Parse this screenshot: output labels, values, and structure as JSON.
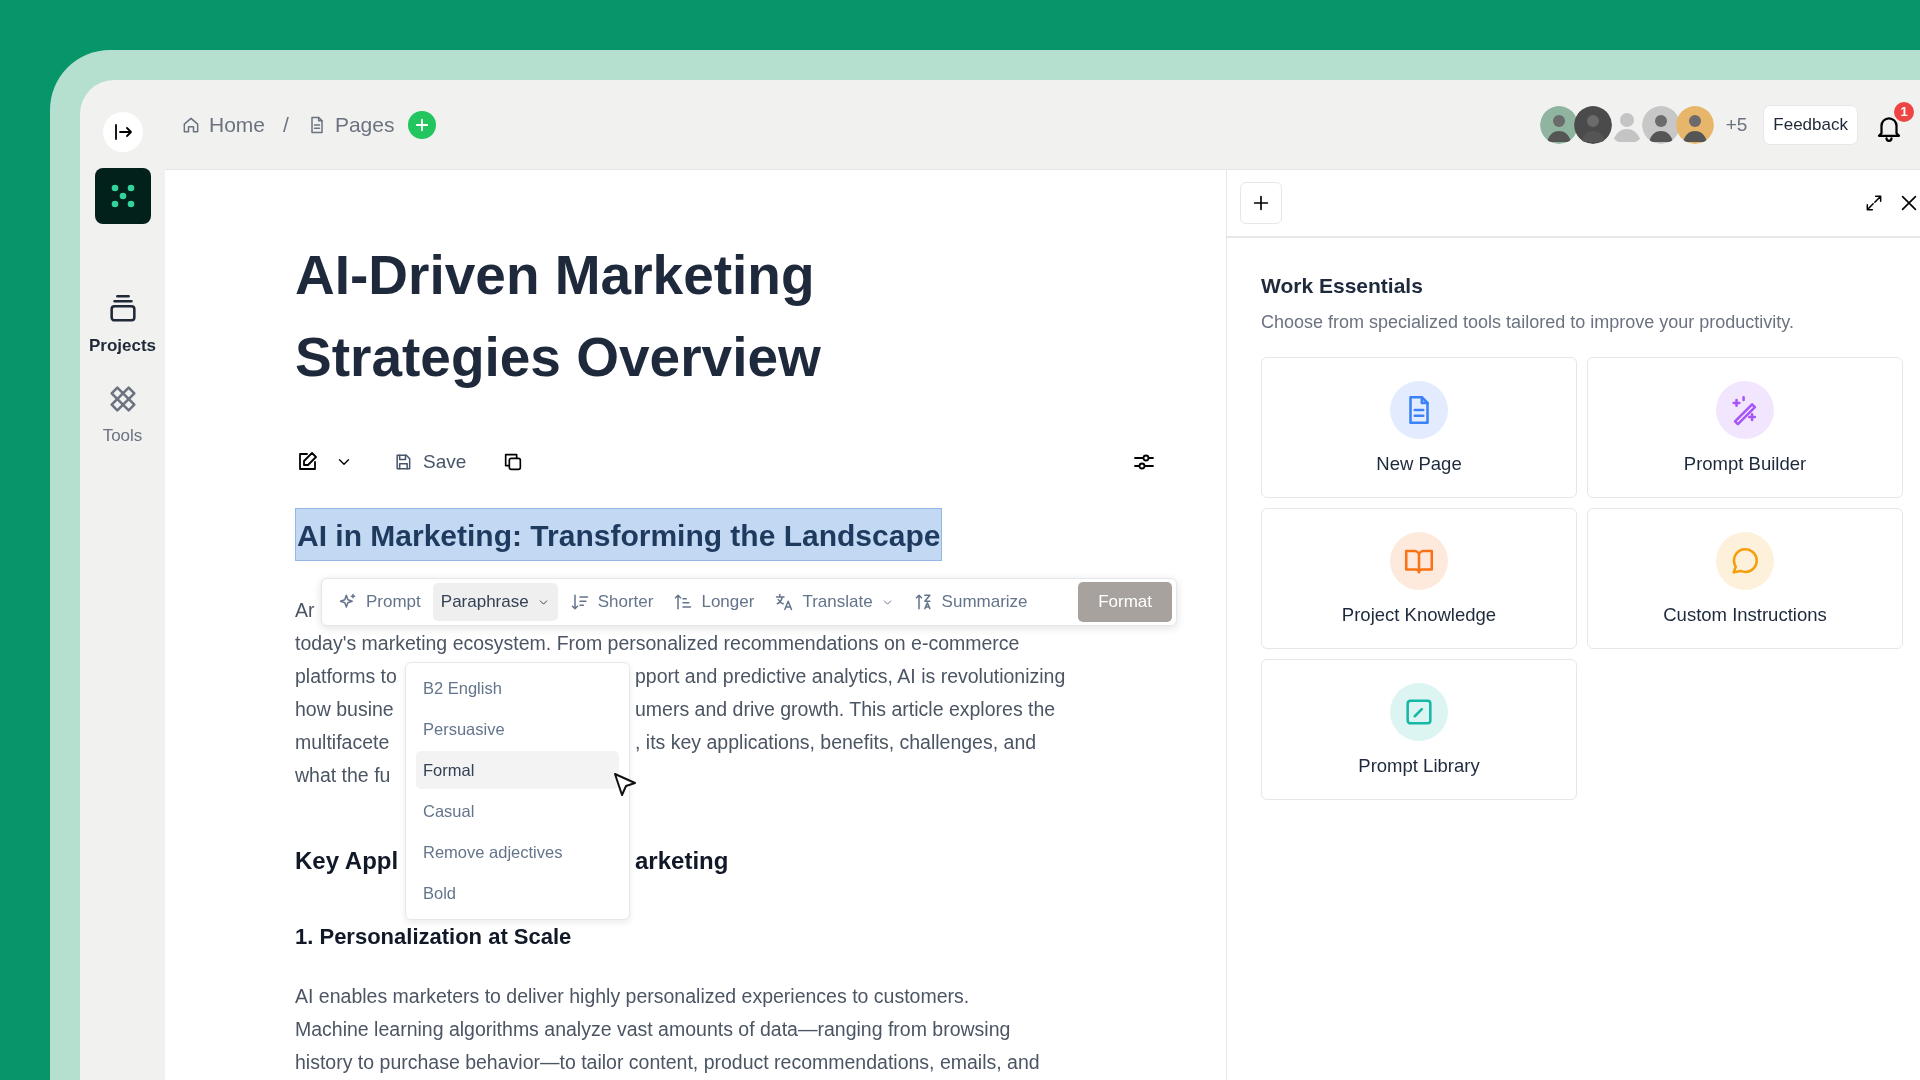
{
  "sidebar": {
    "items": [
      {
        "label": "Projects",
        "selected": true,
        "kind": "projects"
      },
      {
        "label": "Tools",
        "selected": false,
        "kind": "tools"
      }
    ]
  },
  "breadcrumb": {
    "items": [
      {
        "label": "Home",
        "kind": "home"
      },
      {
        "label": "Pages",
        "kind": "page"
      }
    ],
    "separator": "/"
  },
  "collaborators": {
    "avatars": [
      {
        "kind": "photo"
      },
      {
        "kind": "photo"
      },
      {
        "kind": "placeholder"
      },
      {
        "kind": "photo"
      },
      {
        "kind": "photo"
      }
    ],
    "more": "+5"
  },
  "feedback_button": "Feedback",
  "notifications": {
    "badge": "1"
  },
  "document": {
    "title": "AI-Driven Marketing Strategies Overview",
    "toolbar": {
      "save": "Save"
    },
    "selected_heading": "AI in Marketing: Transforming the Landscape",
    "paragraph_lines": [
      {
        "left": "Ar"
      },
      {
        "left": "today's marketing ecosystem. From personalized recommendations on e-commerce"
      },
      {
        "left": "platforms to",
        "right": "pport and predictive analytics, AI is revolutionizing"
      },
      {
        "left": "how busine",
        "right": "umers and drive growth. This article explores the"
      },
      {
        "left": "multifacete",
        "right": ", its key applications, benefits, challenges, and"
      },
      {
        "left": "what the fu"
      }
    ],
    "section_heading": {
      "left": "Key Appl",
      "right": "arketing"
    },
    "subheading": "1. Personalization at Scale",
    "body_lines": [
      "AI enables marketers to deliver highly personalized experiences to customers.",
      "Machine learning algorithms analyze vast amounts of data—ranging from browsing",
      "history to purchase behavior—to tailor content, product recommendations, emails, and"
    ]
  },
  "ai_toolbar": {
    "actions": [
      {
        "label": "Prompt",
        "kind": "prompt",
        "selected": false,
        "dropdown": false
      },
      {
        "label": "Paraphrase",
        "kind": "paraphrase",
        "selected": true,
        "dropdown": true
      },
      {
        "label": "Shorter",
        "kind": "shorter",
        "selected": false,
        "dropdown": false
      },
      {
        "label": "Longer",
        "kind": "longer",
        "selected": false,
        "dropdown": false
      },
      {
        "label": "Translate",
        "kind": "translate",
        "selected": false,
        "dropdown": true
      },
      {
        "label": "Summarize",
        "kind": "summarize",
        "selected": false,
        "dropdown": false
      },
      {
        "label": "Format",
        "kind": "primary",
        "selected": false,
        "dropdown": false
      }
    ]
  },
  "paraphrase_menu": {
    "items": [
      {
        "label": "B2 English",
        "selected": false
      },
      {
        "label": "Persuasive",
        "selected": false
      },
      {
        "label": "Formal",
        "selected": true
      },
      {
        "label": "Casual",
        "selected": false
      },
      {
        "label": "Remove adjectives",
        "selected": false
      },
      {
        "label": "Bold",
        "selected": false
      }
    ]
  },
  "panel": {
    "title": "Work Essentials",
    "subtitle": "Choose from specialized tools tailored to improve your productivity.",
    "tools": [
      {
        "label": "New Page",
        "kind": "page",
        "color": "#3b82f6"
      },
      {
        "label": "Prompt Builder",
        "kind": "wand",
        "color": "#a855f7"
      },
      {
        "label": "Project Knowledge",
        "kind": "book",
        "color": "#f97316"
      },
      {
        "label": "Custom Instructions",
        "kind": "chat",
        "color": "#f59e0b"
      },
      {
        "label": "Prompt Library",
        "kind": "library",
        "color": "#14b8a6"
      }
    ]
  }
}
